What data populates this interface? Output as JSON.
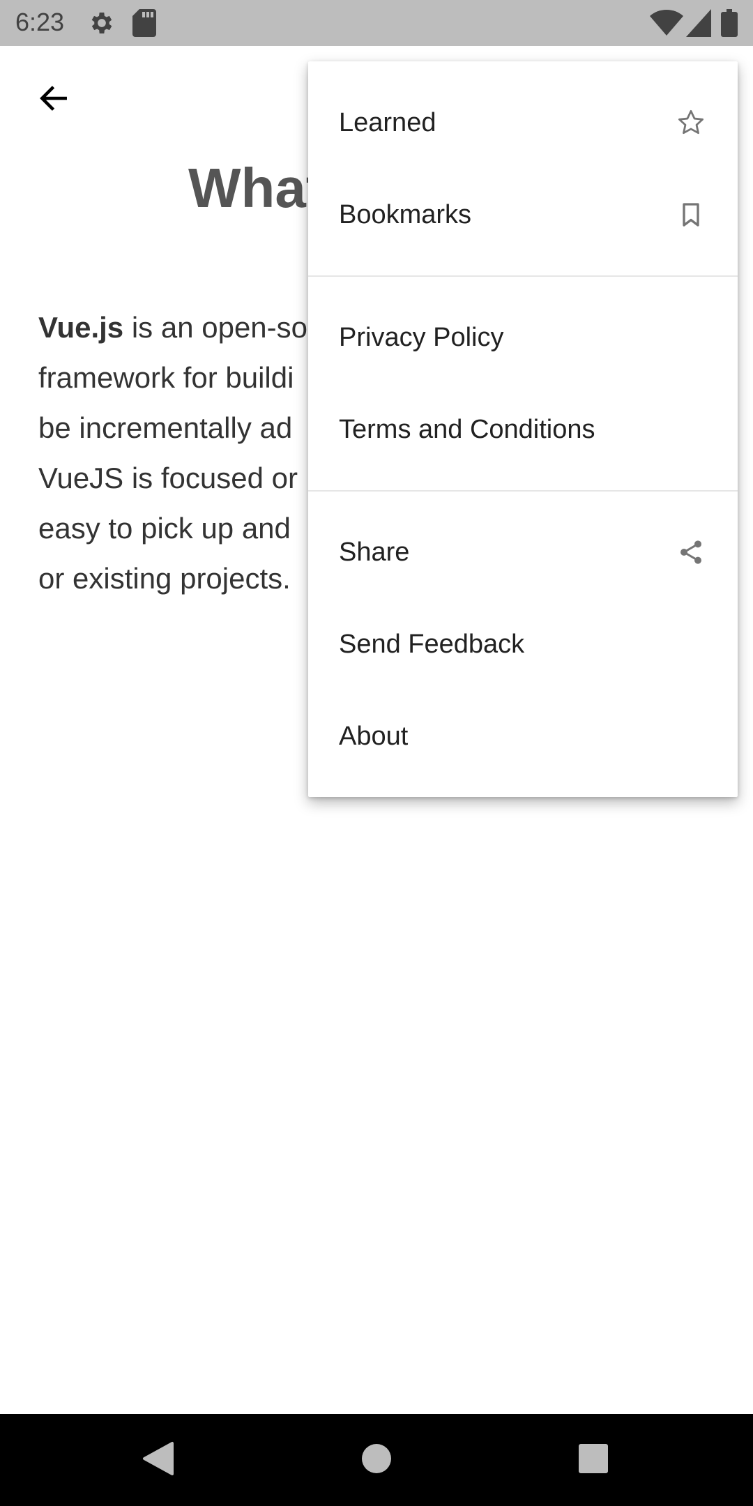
{
  "status_bar": {
    "time": "6:23",
    "icons": [
      "settings-icon",
      "sd-card-icon",
      "wifi-icon",
      "signal-icon",
      "battery-icon"
    ]
  },
  "toolbar": {
    "back_icon": "arrow-left-icon"
  },
  "page": {
    "title": "What",
    "body_lines": [
      {
        "bold": "Vue.js",
        "text": " is an open-so"
      },
      {
        "bold": "",
        "text": "framework for buildi"
      },
      {
        "bold": "",
        "text": "be incrementally ad"
      },
      {
        "bold": "",
        "text": "VueJS is focused or"
      },
      {
        "bold": "",
        "text": "easy to pick up and"
      },
      {
        "bold": "",
        "text": "or existing projects."
      }
    ]
  },
  "menu": {
    "items": [
      {
        "label": "Learned",
        "icon": "star-outline-icon"
      },
      {
        "label": "Bookmarks",
        "icon": "bookmark-outline-icon"
      },
      {
        "label": "Privacy Policy",
        "icon": ""
      },
      {
        "label": "Terms and Conditions",
        "icon": ""
      },
      {
        "label": "Share",
        "icon": "share-icon"
      },
      {
        "label": "Send Feedback",
        "icon": ""
      },
      {
        "label": "About",
        "icon": ""
      }
    ]
  },
  "nav_bar": {
    "buttons": [
      "back-triangle-icon",
      "home-circle-icon",
      "recents-square-icon"
    ]
  },
  "colors": {
    "status_bar_bg": "#bdbdbd",
    "nav_bar_bg": "#000000",
    "menu_icon": "#757575",
    "title": "#555555"
  }
}
